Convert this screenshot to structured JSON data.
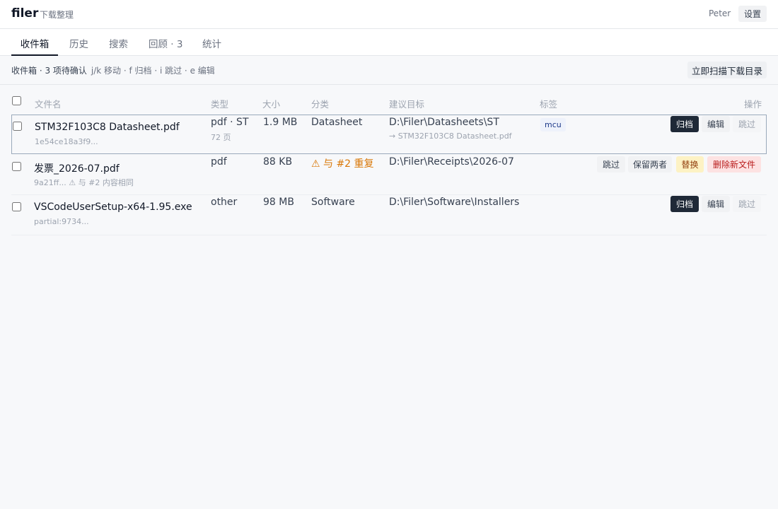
{
  "app": {
    "name": "filer",
    "subtitle": "下载整理"
  },
  "header": {
    "user": "Peter",
    "settings_label": "设置"
  },
  "tabs": [
    {
      "label": "收件箱",
      "active": true
    },
    {
      "label": "历史"
    },
    {
      "label": "搜索"
    },
    {
      "label": "回顾 · 3"
    },
    {
      "label": "统计"
    }
  ],
  "toolbar": {
    "status": "收件箱 · 3 项待确认",
    "hint": "j/k 移动 · f 归档 · i 跳过 · e 编辑",
    "scan_label": "立即扫描下载目录"
  },
  "columns": {
    "filename": "文件名",
    "type": "类型",
    "size": "大小",
    "category": "分类",
    "target": "建议目标",
    "tags": "标签",
    "actions": "操作"
  },
  "rows": [
    {
      "filename": "STM32F103C8 Datasheet.pdf",
      "hash": "1e54ce18a3f9...",
      "type": "pdf · ST",
      "pages": "72 页",
      "size": "1.9 MB",
      "category": "Datasheet",
      "target": "D:\\Filer\\Datasheets\\ST",
      "target_sub": "→ STM32F103C8 Datasheet.pdf",
      "tag": "mcu",
      "actions": [
        "归档",
        "编辑",
        "跳过"
      ]
    },
    {
      "filename": "发票_2026-07.pdf",
      "hash": "9a21ff... ⚠ 与 #2 内容相同",
      "type": "pdf",
      "size": "88 KB",
      "category": "⚠ 与 #2 重复",
      "target": "D:\\Filer\\Receipts\\2026-07",
      "actions": [
        "跳过",
        "保留两者",
        "替换",
        "删除新文件"
      ]
    },
    {
      "filename": "VSCodeUserSetup-x64-1.95.exe",
      "hash": "partial:9734...",
      "type": "other",
      "size": "98 MB",
      "category": "Software",
      "target": "D:\\Filer\\Software\\Installers",
      "actions": [
        "归档",
        "编辑",
        "跳过"
      ]
    }
  ],
  "colors": {
    "primary": "#1f2937",
    "warning": "#d97706",
    "danger_bg": "#fde2e2",
    "replace_bg": "#fdf2c4",
    "tag_bg": "#eef2fb"
  }
}
